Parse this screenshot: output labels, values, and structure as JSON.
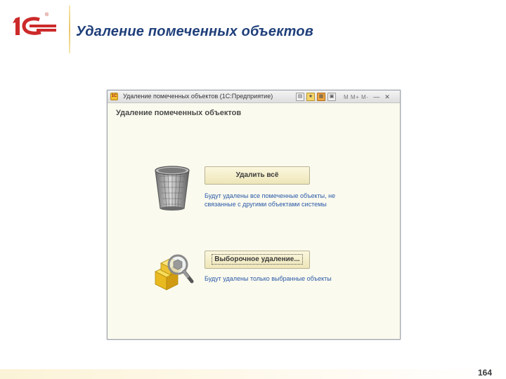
{
  "slide": {
    "logo_text": "1С",
    "logo_reg": "®",
    "title": "Удаление помеченных объектов",
    "page_number": "164"
  },
  "window": {
    "title": "Удаление помеченных объектов  (1С:Предприятие)",
    "toolbar": {
      "memory_label": "M  M+  M-",
      "minimize_glyph": "—",
      "close_glyph": "✕"
    },
    "form_heading": "Удаление помеченных объектов",
    "delete_all": {
      "label": "Удалить всё",
      "description": "Будут удалены все помеченные объекты, не связанные с другими объектами системы"
    },
    "selective": {
      "label": "Выборочное удаление...",
      "description": "Будут удалены только выбранные объекты"
    }
  },
  "colors": {
    "title_blue": "#1f3f7a",
    "logo_red": "#cc2a2a",
    "description_blue": "#2a5aa8",
    "form_background": "#fbfaee"
  },
  "icons": {
    "delete_all": "wastebasket-icon",
    "selective": "magnifier-cubes-icon"
  }
}
